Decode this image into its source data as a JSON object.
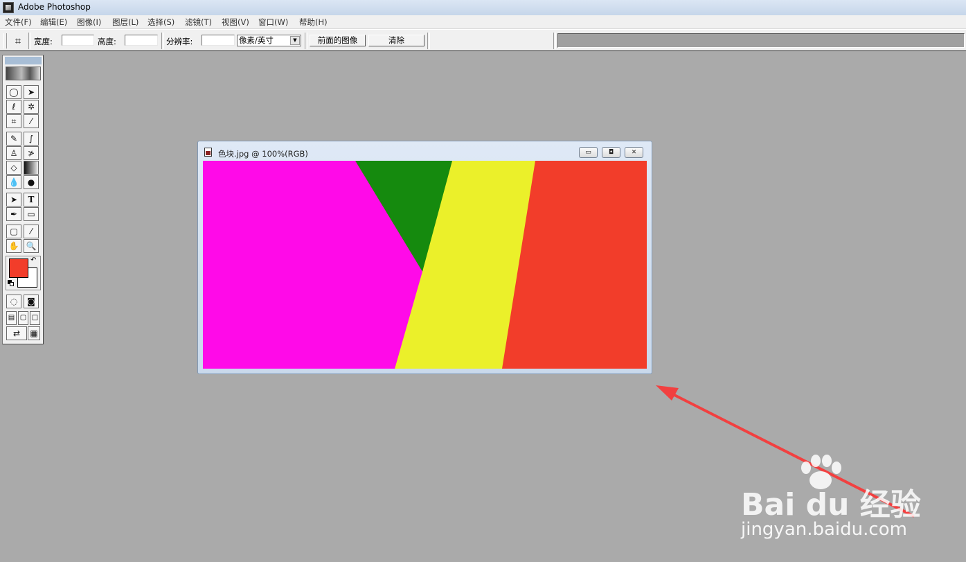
{
  "app": {
    "title": "Adobe Photoshop"
  },
  "menu": [
    "文件(F)",
    "编辑(E)",
    "图像(I)",
    "图层(L)",
    "选择(S)",
    "滤镜(T)",
    "视图(V)",
    "窗口(W)",
    "帮助(H)"
  ],
  "options_bar": {
    "width_label": "宽度:",
    "height_label": "高度:",
    "resolution_label": "分辨率:",
    "unit_value": "像素/英寸",
    "front_image_button": "前面的图像",
    "clear_button": "清除"
  },
  "colors": {
    "foreground": "#f23d2a",
    "background": "#ffffff",
    "magenta": "#ff0ae8",
    "green": "#158a0e",
    "yellow": "#ebf02a",
    "red": "#f23d2a",
    "arrow": "#f24040"
  },
  "document": {
    "title": "色块.jpg @ 100%(RGB)",
    "minimize_symbol": "▭",
    "maximize_symbol": "◘",
    "close_symbol": "✕"
  },
  "watermark": {
    "brand": "Bai  du 经验",
    "url": "jingyan.baidu.com"
  }
}
